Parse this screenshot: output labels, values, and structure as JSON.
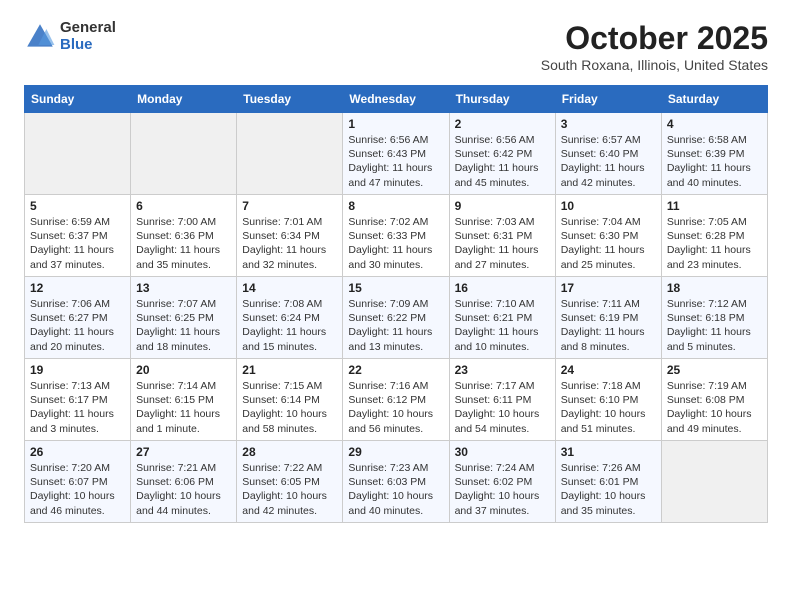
{
  "logo": {
    "general": "General",
    "blue": "Blue"
  },
  "title": "October 2025",
  "subtitle": "South Roxana, Illinois, United States",
  "days_of_week": [
    "Sunday",
    "Monday",
    "Tuesday",
    "Wednesday",
    "Thursday",
    "Friday",
    "Saturday"
  ],
  "weeks": [
    [
      {
        "day": "",
        "info": ""
      },
      {
        "day": "",
        "info": ""
      },
      {
        "day": "",
        "info": ""
      },
      {
        "day": "1",
        "info": "Sunrise: 6:56 AM\nSunset: 6:43 PM\nDaylight: 11 hours\nand 47 minutes."
      },
      {
        "day": "2",
        "info": "Sunrise: 6:56 AM\nSunset: 6:42 PM\nDaylight: 11 hours\nand 45 minutes."
      },
      {
        "day": "3",
        "info": "Sunrise: 6:57 AM\nSunset: 6:40 PM\nDaylight: 11 hours\nand 42 minutes."
      },
      {
        "day": "4",
        "info": "Sunrise: 6:58 AM\nSunset: 6:39 PM\nDaylight: 11 hours\nand 40 minutes."
      }
    ],
    [
      {
        "day": "5",
        "info": "Sunrise: 6:59 AM\nSunset: 6:37 PM\nDaylight: 11 hours\nand 37 minutes."
      },
      {
        "day": "6",
        "info": "Sunrise: 7:00 AM\nSunset: 6:36 PM\nDaylight: 11 hours\nand 35 minutes."
      },
      {
        "day": "7",
        "info": "Sunrise: 7:01 AM\nSunset: 6:34 PM\nDaylight: 11 hours\nand 32 minutes."
      },
      {
        "day": "8",
        "info": "Sunrise: 7:02 AM\nSunset: 6:33 PM\nDaylight: 11 hours\nand 30 minutes."
      },
      {
        "day": "9",
        "info": "Sunrise: 7:03 AM\nSunset: 6:31 PM\nDaylight: 11 hours\nand 27 minutes."
      },
      {
        "day": "10",
        "info": "Sunrise: 7:04 AM\nSunset: 6:30 PM\nDaylight: 11 hours\nand 25 minutes."
      },
      {
        "day": "11",
        "info": "Sunrise: 7:05 AM\nSunset: 6:28 PM\nDaylight: 11 hours\nand 23 minutes."
      }
    ],
    [
      {
        "day": "12",
        "info": "Sunrise: 7:06 AM\nSunset: 6:27 PM\nDaylight: 11 hours\nand 20 minutes."
      },
      {
        "day": "13",
        "info": "Sunrise: 7:07 AM\nSunset: 6:25 PM\nDaylight: 11 hours\nand 18 minutes."
      },
      {
        "day": "14",
        "info": "Sunrise: 7:08 AM\nSunset: 6:24 PM\nDaylight: 11 hours\nand 15 minutes."
      },
      {
        "day": "15",
        "info": "Sunrise: 7:09 AM\nSunset: 6:22 PM\nDaylight: 11 hours\nand 13 minutes."
      },
      {
        "day": "16",
        "info": "Sunrise: 7:10 AM\nSunset: 6:21 PM\nDaylight: 11 hours\nand 10 minutes."
      },
      {
        "day": "17",
        "info": "Sunrise: 7:11 AM\nSunset: 6:19 PM\nDaylight: 11 hours\nand 8 minutes."
      },
      {
        "day": "18",
        "info": "Sunrise: 7:12 AM\nSunset: 6:18 PM\nDaylight: 11 hours\nand 5 minutes."
      }
    ],
    [
      {
        "day": "19",
        "info": "Sunrise: 7:13 AM\nSunset: 6:17 PM\nDaylight: 11 hours\nand 3 minutes."
      },
      {
        "day": "20",
        "info": "Sunrise: 7:14 AM\nSunset: 6:15 PM\nDaylight: 11 hours\nand 1 minute."
      },
      {
        "day": "21",
        "info": "Sunrise: 7:15 AM\nSunset: 6:14 PM\nDaylight: 10 hours\nand 58 minutes."
      },
      {
        "day": "22",
        "info": "Sunrise: 7:16 AM\nSunset: 6:12 PM\nDaylight: 10 hours\nand 56 minutes."
      },
      {
        "day": "23",
        "info": "Sunrise: 7:17 AM\nSunset: 6:11 PM\nDaylight: 10 hours\nand 54 minutes."
      },
      {
        "day": "24",
        "info": "Sunrise: 7:18 AM\nSunset: 6:10 PM\nDaylight: 10 hours\nand 51 minutes."
      },
      {
        "day": "25",
        "info": "Sunrise: 7:19 AM\nSunset: 6:08 PM\nDaylight: 10 hours\nand 49 minutes."
      }
    ],
    [
      {
        "day": "26",
        "info": "Sunrise: 7:20 AM\nSunset: 6:07 PM\nDaylight: 10 hours\nand 46 minutes."
      },
      {
        "day": "27",
        "info": "Sunrise: 7:21 AM\nSunset: 6:06 PM\nDaylight: 10 hours\nand 44 minutes."
      },
      {
        "day": "28",
        "info": "Sunrise: 7:22 AM\nSunset: 6:05 PM\nDaylight: 10 hours\nand 42 minutes."
      },
      {
        "day": "29",
        "info": "Sunrise: 7:23 AM\nSunset: 6:03 PM\nDaylight: 10 hours\nand 40 minutes."
      },
      {
        "day": "30",
        "info": "Sunrise: 7:24 AM\nSunset: 6:02 PM\nDaylight: 10 hours\nand 37 minutes."
      },
      {
        "day": "31",
        "info": "Sunrise: 7:26 AM\nSunset: 6:01 PM\nDaylight: 10 hours\nand 35 minutes."
      },
      {
        "day": "",
        "info": ""
      }
    ]
  ]
}
